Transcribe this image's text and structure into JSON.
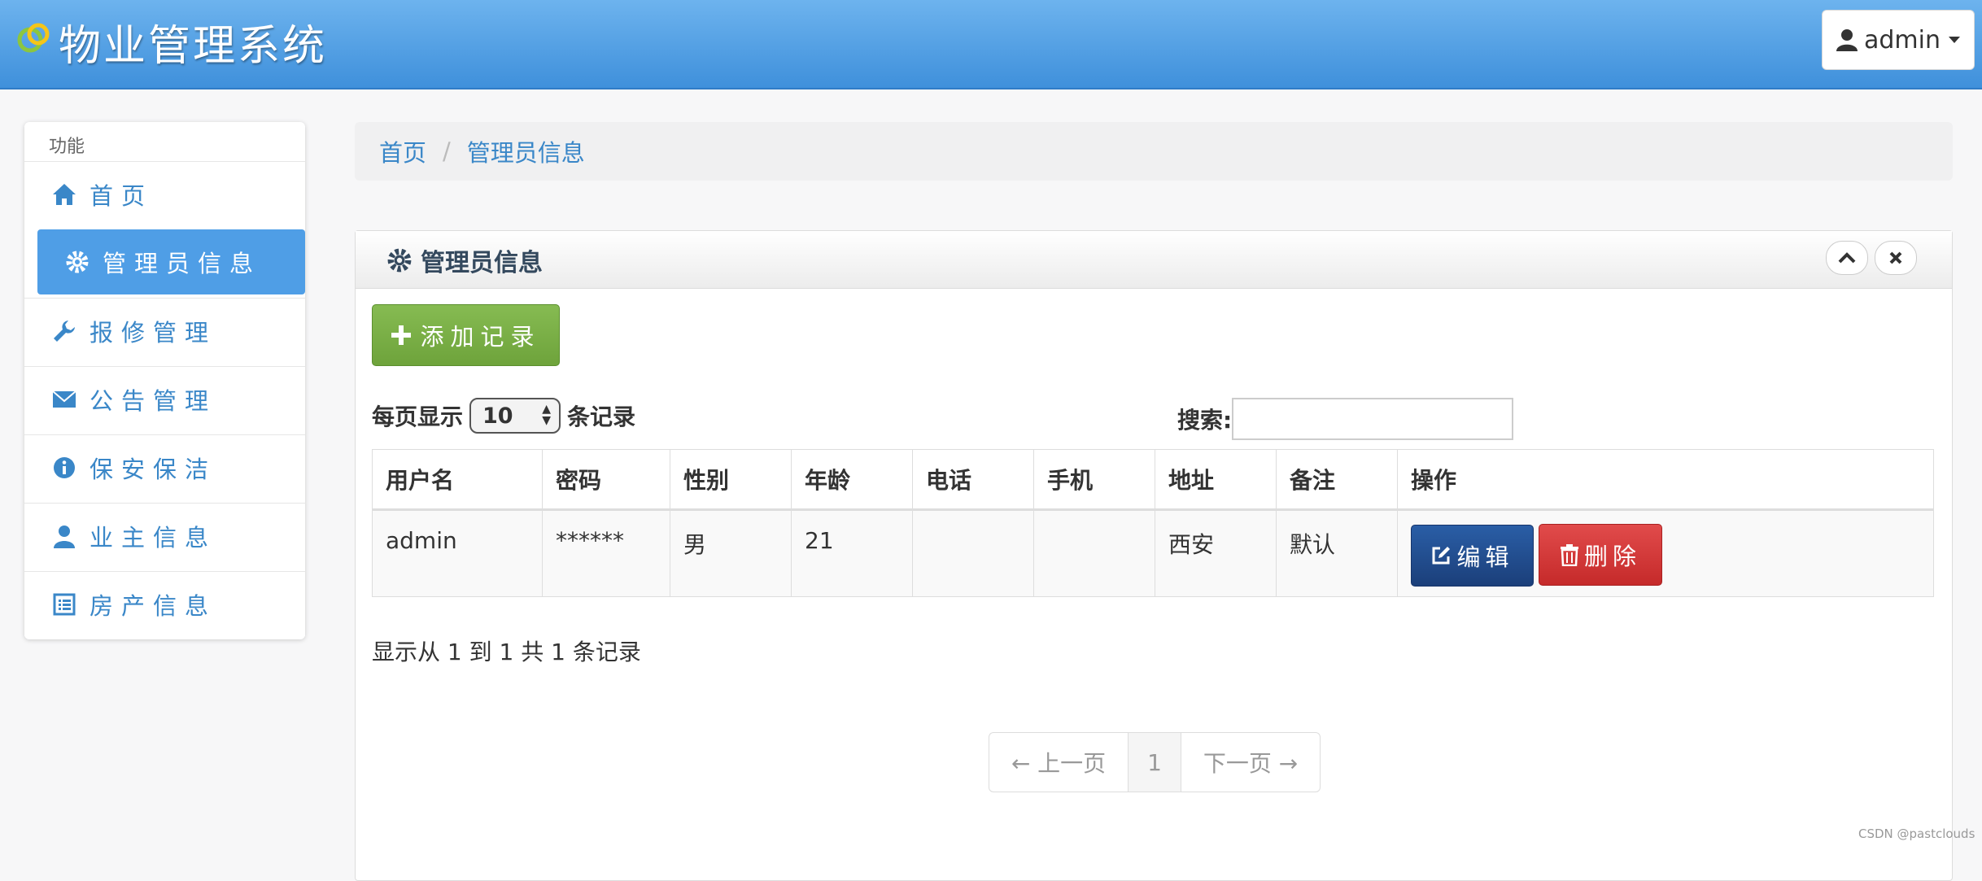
{
  "header": {
    "title": "物业管理系统",
    "user": "admin"
  },
  "sidebar": {
    "heading": "功能",
    "items": [
      {
        "label": "首页",
        "icon": "home-icon"
      },
      {
        "label": "管理员信息",
        "icon": "gear-icon",
        "active": true
      },
      {
        "label": "报修管理",
        "icon": "wrench-icon"
      },
      {
        "label": "公告管理",
        "icon": "envelope-icon"
      },
      {
        "label": "保安保洁",
        "icon": "info-icon"
      },
      {
        "label": "业主信息",
        "icon": "user-icon"
      },
      {
        "label": "房产信息",
        "icon": "list-icon"
      }
    ]
  },
  "breadcrumb": {
    "home": "首页",
    "separator": "/",
    "current": "管理员信息"
  },
  "panel": {
    "title": "管理员信息",
    "add_label": "添加记录",
    "length": {
      "prefix": "每页显示",
      "value": "10",
      "suffix": "条记录"
    },
    "search_label": "搜索:",
    "columns": [
      "用户名",
      "密码",
      "性别",
      "年龄",
      "电话",
      "手机",
      "地址",
      "备注",
      "操作"
    ],
    "rows": [
      {
        "cells": [
          "admin",
          "******",
          "男",
          "21",
          "",
          "",
          "西安",
          "默认"
        ],
        "edit_label": "编辑",
        "delete_label": "删除"
      }
    ],
    "info": "显示从 1 到 1 共 1 条记录",
    "pager": {
      "prev": "← 上一页",
      "page": "1",
      "next": "下一页 →"
    }
  },
  "watermark": "CSDN @pastclouds",
  "colors": {
    "header": "#4a9be3",
    "accent": "#3a87c8",
    "add": "#78ad45",
    "edit": "#22508f",
    "delete": "#d33a3a"
  }
}
